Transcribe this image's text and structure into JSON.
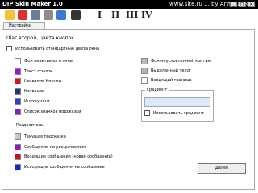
{
  "window": {
    "title": "DIP Skin Maker 1.0",
    "credit": "www.site.ru ... by Аглавдик"
  },
  "toolbar": {
    "icons": [
      "folder-icon",
      "paint-icon",
      "disk-icon",
      "tools-icon",
      "stamp-icon",
      "monitor-icon"
    ],
    "roman": [
      "I",
      "II",
      "III",
      "IV"
    ]
  },
  "tab": {
    "label": "Настройки"
  },
  "section": {
    "title": "Шаг второй, цвета кнопок"
  },
  "checkbox_top": {
    "label": "Использовать стандартные цвета окна"
  },
  "left_rows": [
    {
      "label": "Фон неактивного окна",
      "color": "#ffffff"
    },
    {
      "label": "Текст ссылок",
      "color": "#9b14d4"
    },
    {
      "label": "Название Кнопки",
      "color": "#e0102a"
    },
    {
      "label": "Название",
      "color": "#202f8c"
    },
    {
      "label": "Инструмент",
      "color": "#2246c8"
    },
    {
      "label": "Список значков подсказки",
      "color": "#7b22cc"
    }
  ],
  "sub_header": "Разделитель",
  "left_rows2": [
    {
      "label": "Текущая подсказка",
      "color": "#c8c8c8"
    },
    {
      "label": "Сообщение на уведомлениях",
      "color": "#8a1cc8"
    },
    {
      "label": "Входящие сообщения (новая сообщений)",
      "color": "#d01020"
    },
    {
      "label": "Исходящие сообщения на сообщение",
      "color": "#1626c8"
    }
  ],
  "right_rows": [
    {
      "label": "Фон неусловленный контакт",
      "color": "#b0bac8"
    },
    {
      "label": "Выделенный текст",
      "color": "#a8b8cc"
    },
    {
      "label": "Входящий граница",
      "color": "#ffffff"
    }
  ],
  "group": {
    "label": "Градиент",
    "checkbox_label": "Использовать градиент"
  },
  "button": {
    "label": "Далее"
  }
}
